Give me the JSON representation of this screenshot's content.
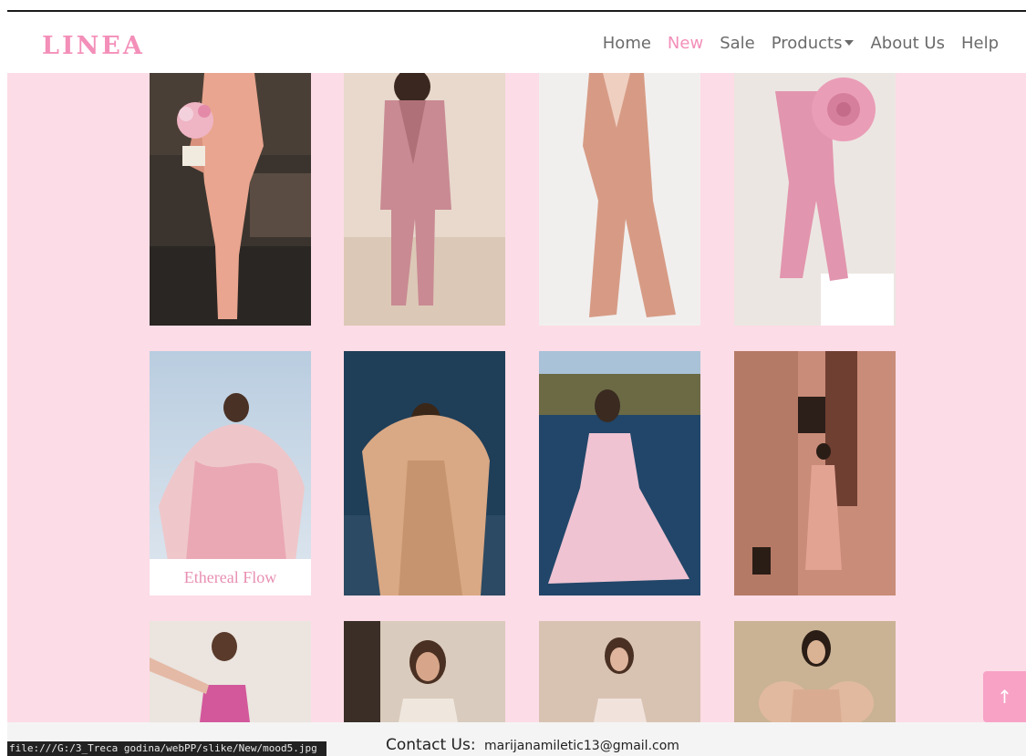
{
  "brand": "LINEA",
  "nav": {
    "home": "Home",
    "new": "New",
    "sale": "Sale",
    "products": "Products",
    "about": "About Us",
    "help": "Help"
  },
  "colors": {
    "brand": "#f38fb9",
    "page_bg": "#fcdce6",
    "nav_text": "#6b6b6b",
    "active_nav": "#f38fb9"
  },
  "gallery": {
    "row1": [
      "pink-suit-bouquet",
      "mauve-suit-sand",
      "blush-suit-studio",
      "pink-rose-suit"
    ],
    "row2": [
      "ethereal-flow",
      "tulle-gown-night",
      "pink-gown-lake",
      "pink-dress-wall"
    ],
    "row2_caption": "Ethereal Flow",
    "row3": [
      "pink-strapless",
      "white-dress-window",
      "corset-dress",
      "puff-sleeve"
    ]
  },
  "footer": {
    "contact_label": "Contact Us:",
    "email": "marijanamiletic13@gmail.com"
  },
  "status_url": "file:///G:/3_Treca godina/webPP/slike/New/mood5.jpg",
  "scroll_top_icon": "arrow-up-icon",
  "scroll_top_glyph": "↑"
}
